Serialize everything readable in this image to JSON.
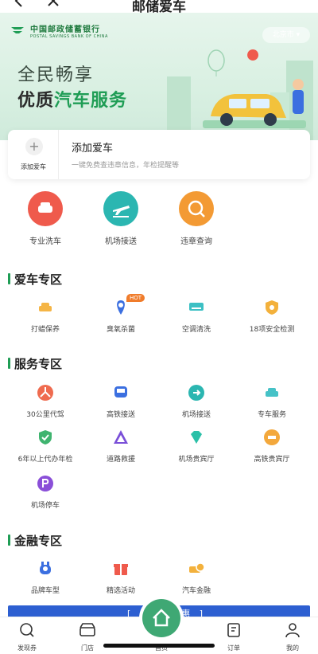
{
  "nav": {
    "title": "邮储爱车"
  },
  "banner": {
    "bank_name_cn": "中国邮政储蓄银行",
    "bank_name_en": "POSTAL SAVINGS BANK OF CHINA",
    "city": "北京市",
    "slogan_line1": "全民畅享",
    "slogan_line2_a": "优质",
    "slogan_line2_b": "汽车服务"
  },
  "add_car": {
    "button_label": "添加爱车",
    "title": "添加爱车",
    "subtitle": "一键免费查违章信息，年检提醒等"
  },
  "top_services": [
    {
      "label": "专业洗车",
      "color": "#ef5a4c"
    },
    {
      "label": "机场接送",
      "color": "#2bb6b1"
    },
    {
      "label": "违章查询",
      "color": "#f39a34"
    }
  ],
  "sections": {
    "car": {
      "title": "爱车专区",
      "items": [
        {
          "label": "打蜡保养"
        },
        {
          "label": "臭氧杀菌",
          "badge": "HOT"
        },
        {
          "label": "空调清洗"
        },
        {
          "label": "18项安全检测"
        }
      ]
    },
    "service": {
      "title": "服务专区",
      "items": [
        {
          "label": "30公里代驾"
        },
        {
          "label": "高铁接送"
        },
        {
          "label": "机场接送"
        },
        {
          "label": "专车服务"
        },
        {
          "label": "6年以上代办年检"
        },
        {
          "label": "道路救援"
        },
        {
          "label": "机场贵宾厅"
        },
        {
          "label": "高铁贵宾厅"
        },
        {
          "label": "机场停车"
        }
      ]
    },
    "finance": {
      "title": "金融专区",
      "items": [
        {
          "label": "品牌车型"
        },
        {
          "label": "精选活动"
        },
        {
          "label": "汽车金融"
        }
      ]
    }
  },
  "blue_banner": {
    "text": "[ 邮 ... 惠 ]"
  },
  "tabbar": {
    "items": [
      {
        "label": "发现券"
      },
      {
        "label": "门店"
      },
      {
        "label": "首页"
      },
      {
        "label": "订单"
      },
      {
        "label": "我的"
      }
    ]
  },
  "colors": {
    "accent": "#1f9d55",
    "orange": "#f39a34",
    "blue": "#3b6fe0"
  }
}
